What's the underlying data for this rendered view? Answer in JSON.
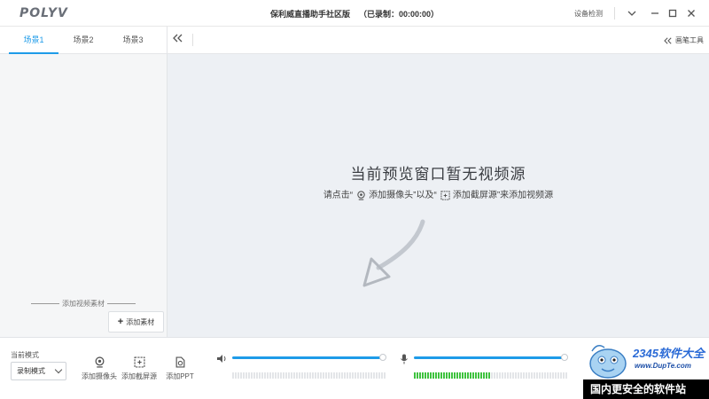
{
  "app": {
    "logo": "POLYV",
    "title": "保利威直播助手社区版",
    "recorded": "（已录制：00:00:00）",
    "device_check": "设备检测"
  },
  "scenes": {
    "tabs": [
      "场景1",
      "场景2",
      "场景3"
    ],
    "active": 0,
    "add_material_label": "添加视频素材",
    "add_material_button": "添加素材"
  },
  "preview": {
    "brush_tools": "画笔工具",
    "empty_title": "当前预览窗口暂无视频源",
    "hint_prefix": "请点击“",
    "hint_camera": "添加摄像头",
    "hint_middle": "”以及“",
    "hint_screen": "添加截屏源",
    "hint_suffix": "”来添加视频源"
  },
  "bottom": {
    "mode_label": "当前模式",
    "mode_value": "录制模式",
    "tools": [
      "添加摄像头",
      "添加截屏源",
      "添加PPT"
    ],
    "speaker_volume": 1.0,
    "mic_volume": 1.0,
    "speaker_level": 0.0,
    "mic_level": 0.5
  },
  "watermark": {
    "brand": "2345软件大全",
    "url": "www.DupTe.com",
    "slogan": "国内更安全的软件站"
  },
  "colors": {
    "accent": "#1e9be8",
    "meter_on": "#3ec23e",
    "preview_bg": "#edf0f4"
  }
}
